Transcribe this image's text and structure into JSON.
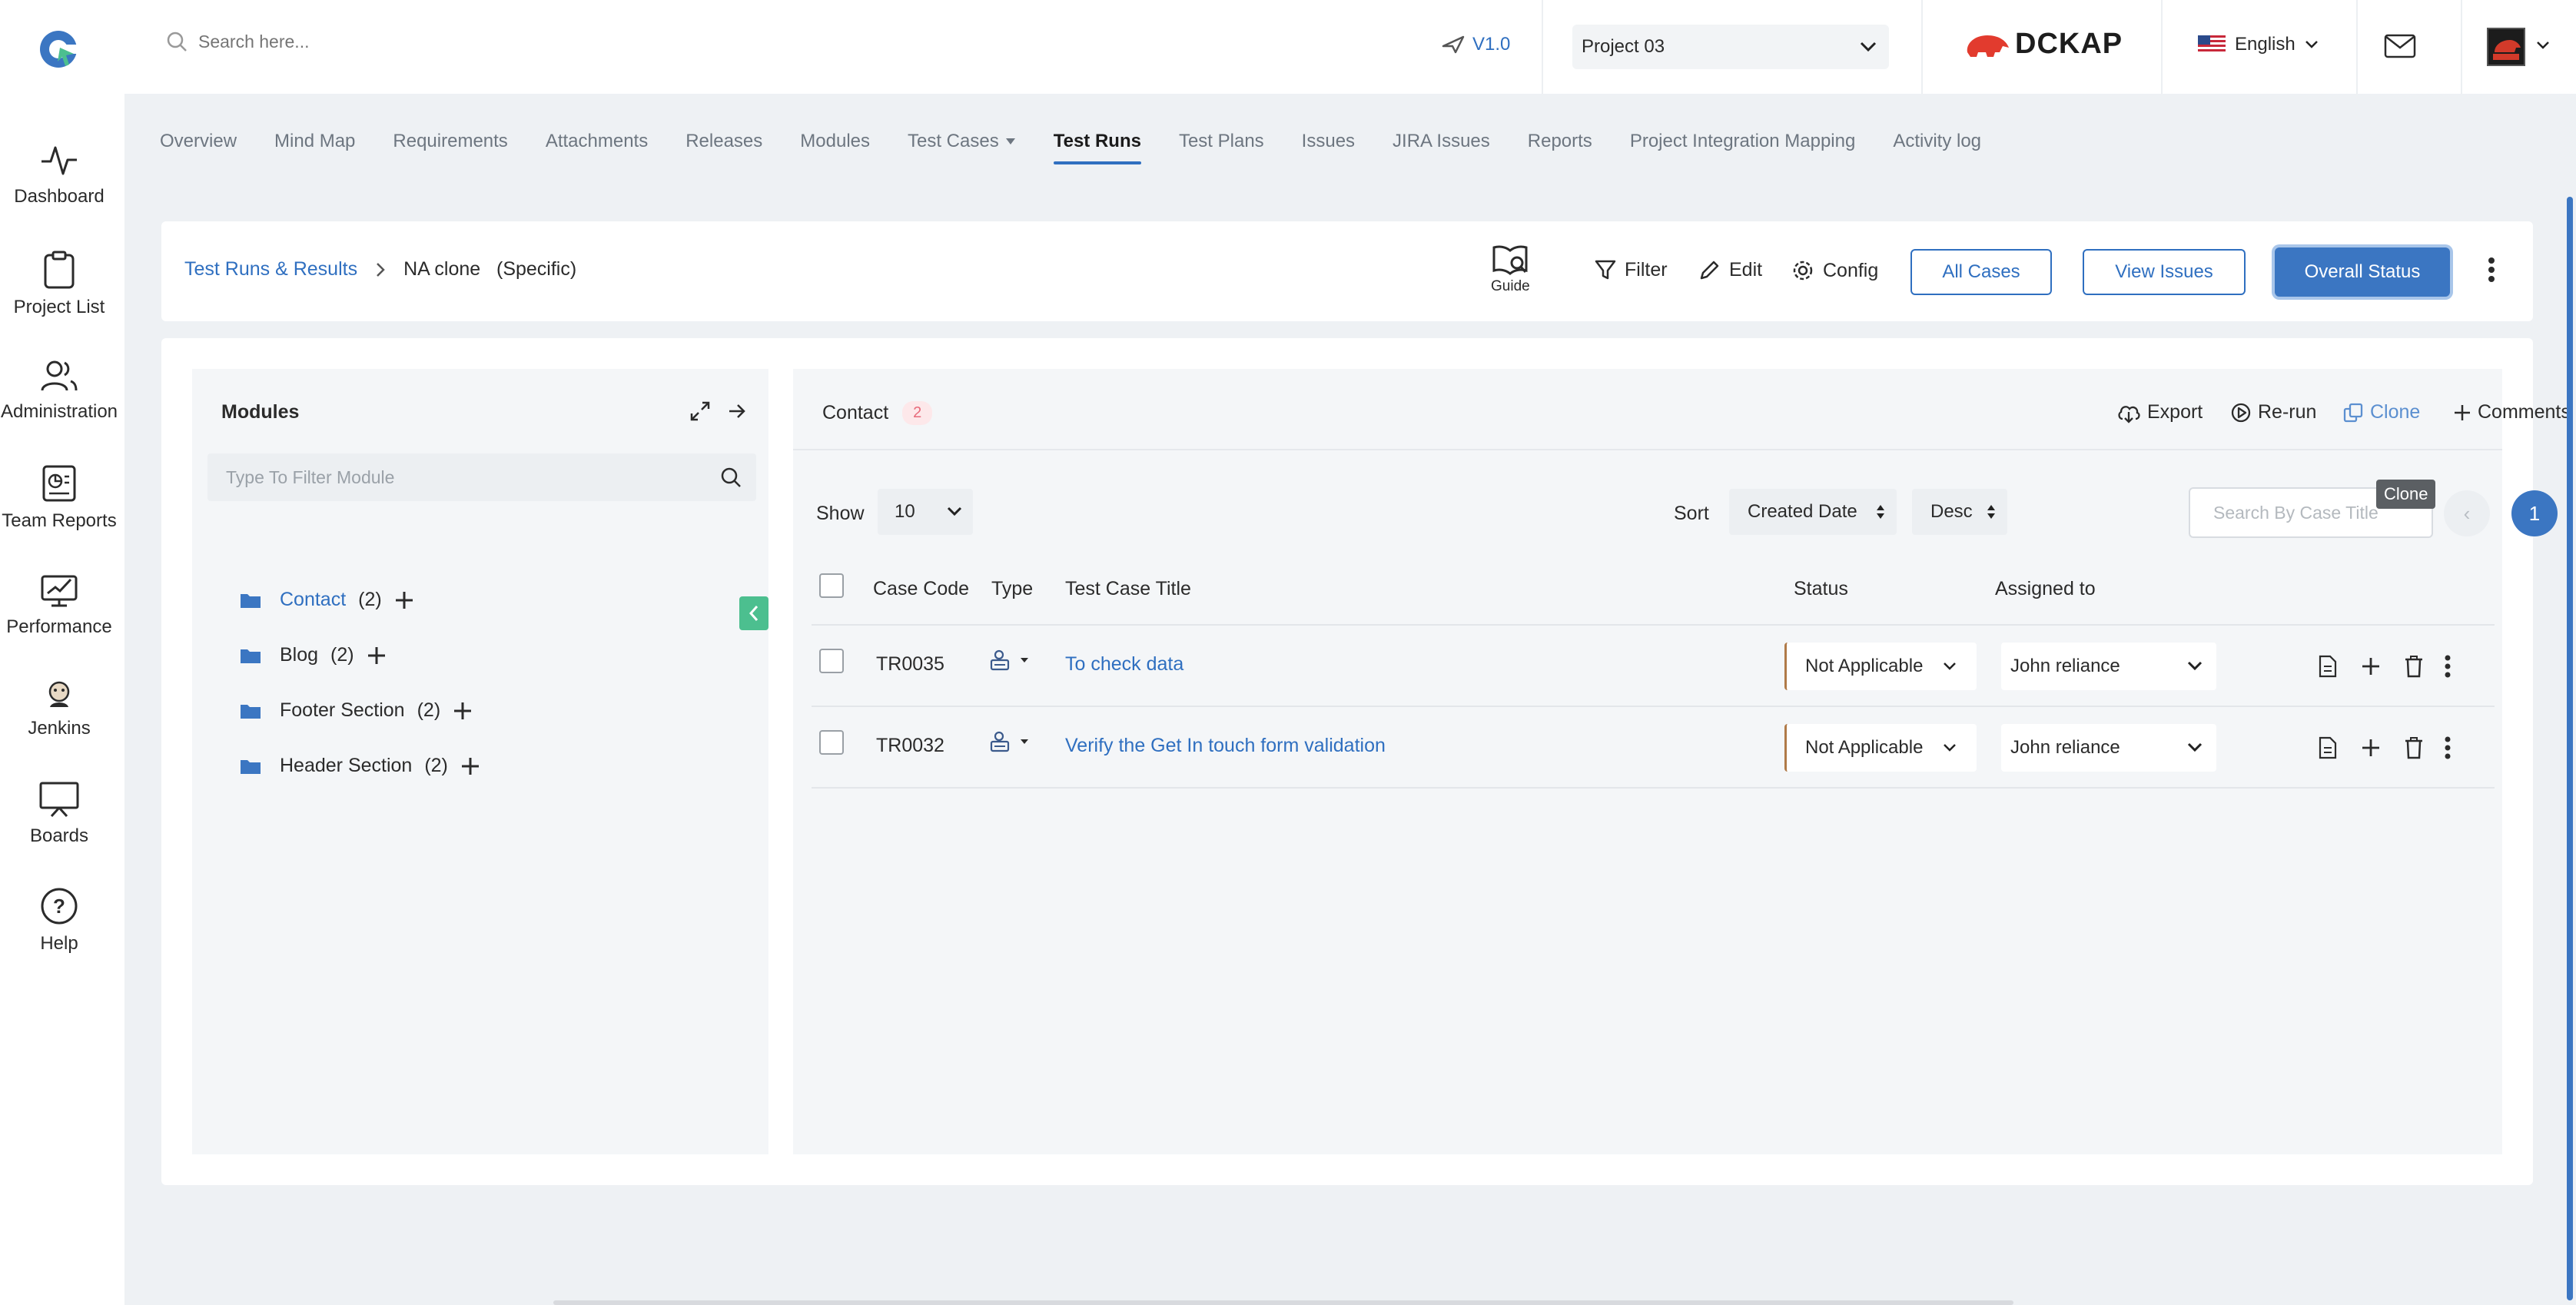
{
  "search": {
    "placeholder": "Search here..."
  },
  "header": {
    "version": "V1.0",
    "project": "Project 03",
    "brand": "DCKAP",
    "language": "English"
  },
  "sidebar": {
    "items": [
      {
        "label": "Dashboard",
        "icon": "pulse-icon"
      },
      {
        "label": "Project List",
        "icon": "clipboard-icon"
      },
      {
        "label": "Administration",
        "icon": "users-icon"
      },
      {
        "label": "Team Reports",
        "icon": "report-icon"
      },
      {
        "label": "Performance",
        "icon": "performance-icon"
      },
      {
        "label": "Jenkins",
        "icon": "jenkins-icon"
      },
      {
        "label": "Boards",
        "icon": "board-icon"
      },
      {
        "label": "Help",
        "icon": "help-icon"
      }
    ]
  },
  "tabs": [
    "Overview",
    "Mind Map",
    "Requirements",
    "Attachments",
    "Releases",
    "Modules",
    "Test Cases",
    "Test Runs",
    "Test Plans",
    "Issues",
    "JIRA Issues",
    "Reports",
    "Project Integration Mapping",
    "Activity log"
  ],
  "active_tab": "Test Runs",
  "breadcrumb": {
    "root": "Test Runs & Results",
    "current": "NA clone",
    "qualifier": "(Specific)"
  },
  "toolbar": {
    "guide": "Guide",
    "filter": "Filter",
    "edit": "Edit",
    "config": "Config",
    "all_cases": "All Cases",
    "view_issues": "View Issues",
    "overall_status": "Overall Status"
  },
  "modules": {
    "title": "Modules",
    "filter_placeholder": "Type To Filter Module",
    "items": [
      {
        "name": "Contact",
        "count": "(2)"
      },
      {
        "name": "Blog",
        "count": "(2)"
      },
      {
        "name": "Footer Section",
        "count": "(2)"
      },
      {
        "name": "Header Section",
        "count": "(2)"
      }
    ]
  },
  "cases": {
    "module": "Contact",
    "count": "2",
    "actions": {
      "export": "Export",
      "rerun": "Re-run",
      "clone": "Clone",
      "comments": "Comments"
    },
    "tooltip": "Clone",
    "show_label": "Show",
    "show_value": "10",
    "sort_label": "Sort",
    "sort_field": "Created Date",
    "sort_order": "Desc",
    "search_placeholder": "Search By Case Title",
    "page": "1",
    "prev": "‹",
    "next": "›",
    "columns": {
      "code": "Case Code",
      "type": "Type",
      "title": "Test Case Title",
      "status": "Status",
      "assigned": "Assigned to"
    },
    "rows": [
      {
        "code": "TR0035",
        "title": "To check data",
        "status": "Not Applicable",
        "assigned": "John reliance"
      },
      {
        "code": "TR0032",
        "title": "Verify the Get In touch form validation",
        "status": "Not Applicable",
        "assigned": "John reliance"
      }
    ]
  },
  "colors": {
    "accent": "#2f6fc0",
    "primary_button": "#3b76c2",
    "collapse_tab": "#4cbf8f",
    "badge_text": "#e86a7a"
  }
}
